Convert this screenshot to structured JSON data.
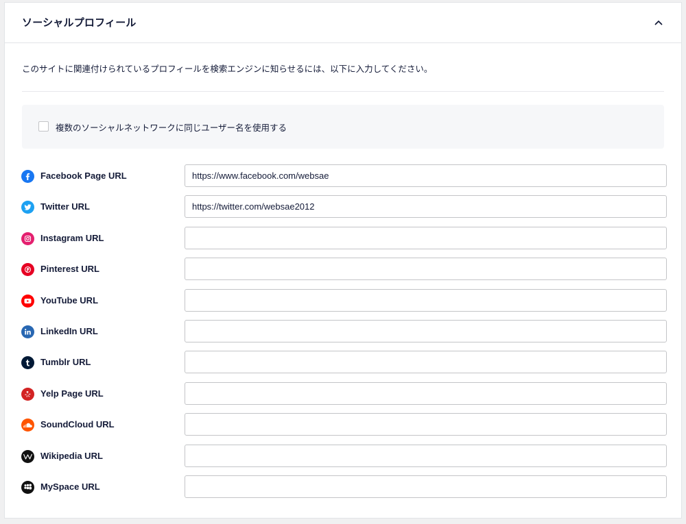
{
  "panel": {
    "title": "ソーシャルプロフィール",
    "collapse_icon": "chevron-up-icon",
    "description": "このサイトに関連付けられているプロフィールを検索エンジンに知らせるには、以下に入力してください。",
    "same_username_checkbox": {
      "label": "複数のソーシャルネットワークに同じユーザー名を使用する",
      "checked": false
    }
  },
  "profiles": [
    {
      "label": "Facebook Page URL",
      "value": "https://www.facebook.com/websae",
      "icon": "facebook-icon",
      "color": "#1877f2"
    },
    {
      "label": "Twitter URL",
      "value": "https://twitter.com/websae2012",
      "icon": "twitter-icon",
      "color": "#1da1f2"
    },
    {
      "label": "Instagram URL",
      "value": "",
      "icon": "instagram-icon",
      "color": "#e4206f"
    },
    {
      "label": "Pinterest URL",
      "value": "",
      "icon": "pinterest-icon",
      "color": "#e60023"
    },
    {
      "label": "YouTube URL",
      "value": "",
      "icon": "youtube-icon",
      "color": "#ff0000"
    },
    {
      "label": "LinkedIn URL",
      "value": "",
      "icon": "linkedin-icon",
      "color": "#2867b2"
    },
    {
      "label": "Tumblr URL",
      "value": "",
      "icon": "tumblr-icon",
      "color": "#001935"
    },
    {
      "label": "Yelp Page URL",
      "value": "",
      "icon": "yelp-icon",
      "color": "#d32323"
    },
    {
      "label": "SoundCloud URL",
      "value": "",
      "icon": "soundcloud-icon",
      "color": "#ff5500"
    },
    {
      "label": "Wikipedia URL",
      "value": "",
      "icon": "wikipedia-icon",
      "color": "#111111"
    },
    {
      "label": "MySpace URL",
      "value": "",
      "icon": "myspace-icon",
      "color": "#111111"
    }
  ]
}
